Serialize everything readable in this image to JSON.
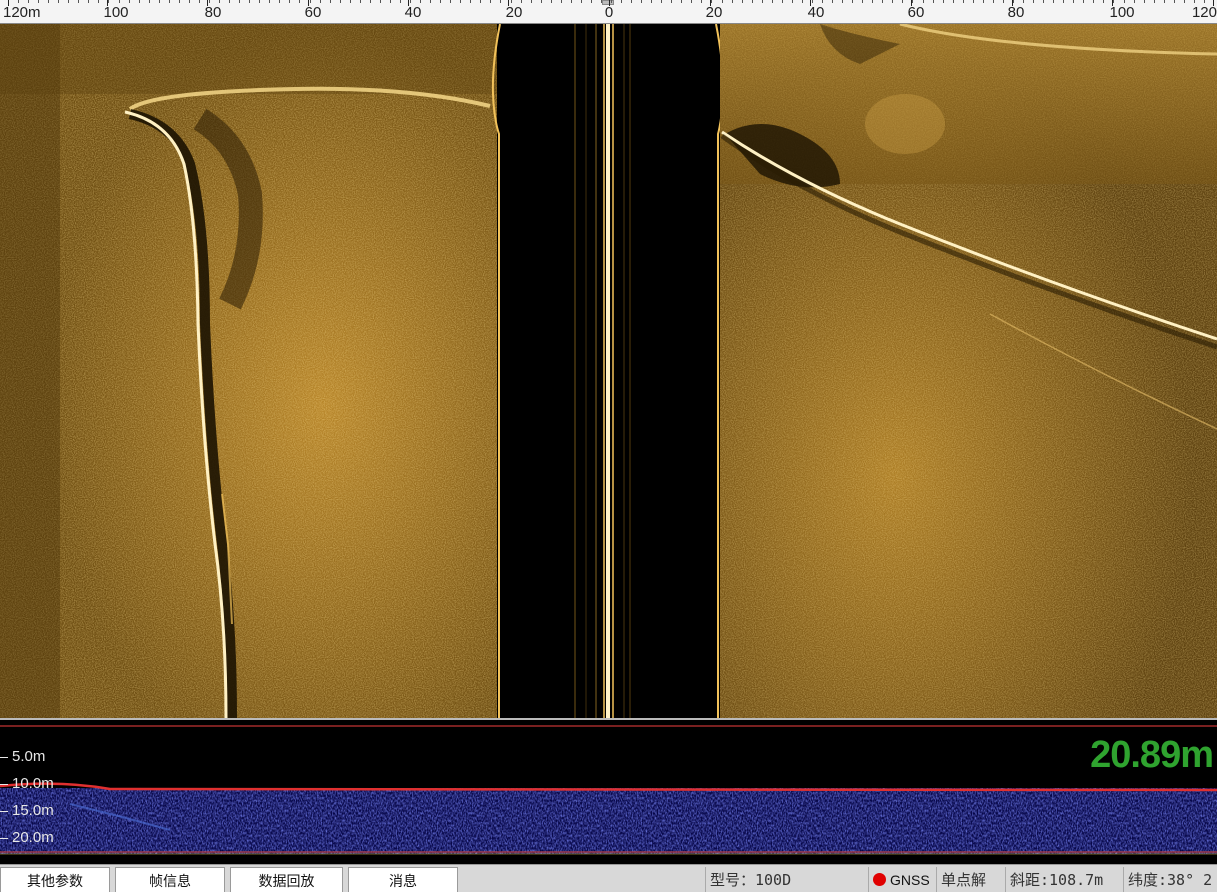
{
  "ruler": {
    "unit_label_left": "120m",
    "unit_label_right": "120",
    "labels": [
      "100",
      "80",
      "60",
      "40",
      "20",
      "0",
      "20",
      "40",
      "60",
      "80",
      "100"
    ]
  },
  "depth": {
    "scale_labels": [
      "5.0m",
      "10.0m",
      "15.0m",
      "20.0m"
    ],
    "current_depth": "20.89m"
  },
  "tabs": [
    {
      "label": "其他参数"
    },
    {
      "label": "帧信息"
    },
    {
      "label": "数据回放"
    },
    {
      "label": "消息"
    }
  ],
  "status": {
    "model": "型号：100D",
    "gnss_label": "GNSS",
    "gnss_status_color": "#e00000",
    "solution": "单点解",
    "slant_range": "斜距:108.7m",
    "latitude": "纬度:38° 2"
  },
  "colors": {
    "sonar_base": "#8a6418",
    "sonar_bright": "#f2c25a",
    "depth_value": "#2fa32f"
  }
}
